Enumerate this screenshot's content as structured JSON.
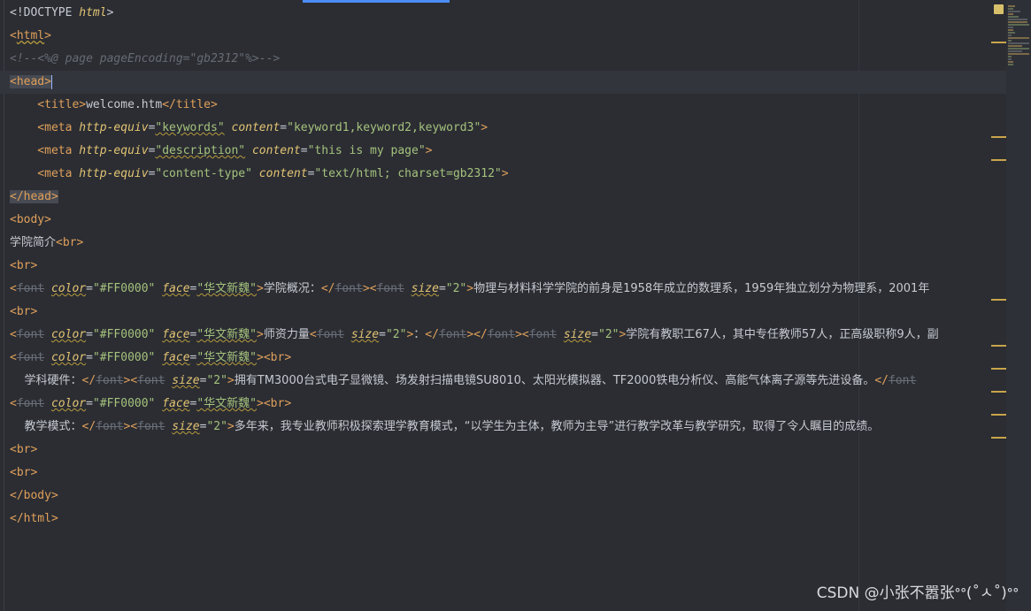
{
  "editor": {
    "lines": [
      {
        "tokens": [
          {
            "t": "<!DOCTYPE ",
            "c": "tk-doctype"
          },
          {
            "t": "html",
            "c": "tk-doctype-name"
          },
          {
            "t": ">",
            "c": "tk-doctype"
          }
        ]
      },
      {
        "tokens": [
          {
            "t": "<",
            "c": "tk-tag"
          },
          {
            "t": "html",
            "c": "tk-tag squigt"
          },
          {
            "t": ">",
            "c": "tk-tag"
          }
        ]
      },
      {
        "tokens": [
          {
            "t": "<!--<%@ page pageEncoding=\"gb2312\"%>-->",
            "c": "tk-comment"
          }
        ]
      },
      {
        "current": true,
        "tokens": [
          {
            "t": "<head>",
            "c": "tk-tag tagbox"
          },
          {
            "t": "",
            "c": "cursor"
          }
        ]
      },
      {
        "tokens": [
          {
            "t": "    <",
            "c": "tk-tag"
          },
          {
            "t": "title",
            "c": "tk-tag"
          },
          {
            "t": ">",
            "c": "tk-tag"
          },
          {
            "t": "welcome.htm",
            "c": "tk-punc"
          },
          {
            "t": "</",
            "c": "tk-tag"
          },
          {
            "t": "title",
            "c": "tk-tag"
          },
          {
            "t": ">",
            "c": "tk-tag"
          }
        ]
      },
      {
        "tokens": [
          {
            "t": "    <",
            "c": "tk-tag"
          },
          {
            "t": "meta ",
            "c": "tk-tag"
          },
          {
            "t": "http-equiv",
            "c": "tk-attr"
          },
          {
            "t": "=",
            "c": "tk-eq"
          },
          {
            "t": "\"keywords\"",
            "c": "tk-str squig"
          },
          {
            "t": " ",
            "c": "tk-punc"
          },
          {
            "t": "content",
            "c": "tk-attr"
          },
          {
            "t": "=",
            "c": "tk-eq"
          },
          {
            "t": "\"keyword1,keyword2,keyword3\"",
            "c": "tk-str"
          },
          {
            "t": ">",
            "c": "tk-tag"
          }
        ]
      },
      {
        "tokens": [
          {
            "t": "    <",
            "c": "tk-tag"
          },
          {
            "t": "meta ",
            "c": "tk-tag"
          },
          {
            "t": "http-equiv",
            "c": "tk-attr"
          },
          {
            "t": "=",
            "c": "tk-eq"
          },
          {
            "t": "\"description\"",
            "c": "tk-str squig"
          },
          {
            "t": " ",
            "c": "tk-punc"
          },
          {
            "t": "content",
            "c": "tk-attr"
          },
          {
            "t": "=",
            "c": "tk-eq"
          },
          {
            "t": "\"this is my page\"",
            "c": "tk-str"
          },
          {
            "t": ">",
            "c": "tk-tag"
          }
        ]
      },
      {
        "tokens": [
          {
            "t": "    <",
            "c": "tk-tag"
          },
          {
            "t": "meta ",
            "c": "tk-tag"
          },
          {
            "t": "http-equiv",
            "c": "tk-attr"
          },
          {
            "t": "=",
            "c": "tk-eq"
          },
          {
            "t": "\"content-type\"",
            "c": "tk-str"
          },
          {
            "t": " ",
            "c": "tk-punc"
          },
          {
            "t": "content",
            "c": "tk-attr"
          },
          {
            "t": "=",
            "c": "tk-eq"
          },
          {
            "t": "\"text/html; charset=gb2312\"",
            "c": "tk-str"
          },
          {
            "t": ">",
            "c": "tk-tag"
          }
        ]
      },
      {
        "tokens": [
          {
            "t": "</head>",
            "c": "tk-tag tagbox"
          }
        ]
      },
      {
        "tokens": [
          {
            "t": "<",
            "c": "tk-tag"
          },
          {
            "t": "body",
            "c": "tk-tag"
          },
          {
            "t": ">",
            "c": "tk-tag"
          }
        ]
      },
      {
        "tokens": [
          {
            "t": "学院简介",
            "c": "tk-text"
          },
          {
            "t": "<",
            "c": "tk-tag"
          },
          {
            "t": "br",
            "c": "tk-tag"
          },
          {
            "t": ">",
            "c": "tk-tag"
          }
        ]
      },
      {
        "tokens": [
          {
            "t": "<",
            "c": "tk-tag"
          },
          {
            "t": "br",
            "c": "tk-tag"
          },
          {
            "t": ">",
            "c": "tk-tag"
          }
        ]
      },
      {
        "tokens": [
          {
            "t": "<",
            "c": "tk-tag"
          },
          {
            "t": "font",
            "c": "tk-strike"
          },
          {
            "t": " ",
            "c": "tk-punc"
          },
          {
            "t": "color",
            "c": "tk-attr squig"
          },
          {
            "t": "=",
            "c": "tk-eq"
          },
          {
            "t": "\"#FF0000\"",
            "c": "tk-str"
          },
          {
            "t": " ",
            "c": "tk-punc"
          },
          {
            "t": "face",
            "c": "tk-attr squig"
          },
          {
            "t": "=",
            "c": "tk-eq"
          },
          {
            "t": "\"华文新魏\"",
            "c": "tk-str squig"
          },
          {
            "t": ">",
            "c": "tk-tag"
          },
          {
            "t": "学院概况：",
            "c": "tk-text"
          },
          {
            "t": "</",
            "c": "tk-tag"
          },
          {
            "t": "font",
            "c": "tk-strike"
          },
          {
            "t": ">",
            "c": "tk-tag"
          },
          {
            "t": "<",
            "c": "tk-tag"
          },
          {
            "t": "font",
            "c": "tk-strike"
          },
          {
            "t": " ",
            "c": "tk-punc"
          },
          {
            "t": "size",
            "c": "tk-attr squig"
          },
          {
            "t": "=",
            "c": "tk-eq"
          },
          {
            "t": "\"2\"",
            "c": "tk-str"
          },
          {
            "t": ">",
            "c": "tk-tag"
          },
          {
            "t": "物理与材料科学学院的前身是1958年成立的数理系，1959年独立划分为物理系，2001年",
            "c": "tk-text"
          }
        ]
      },
      {
        "tokens": [
          {
            "t": "<",
            "c": "tk-tag"
          },
          {
            "t": "br",
            "c": "tk-tag"
          },
          {
            "t": ">",
            "c": "tk-tag"
          }
        ]
      },
      {
        "tokens": [
          {
            "t": "<",
            "c": "tk-tag"
          },
          {
            "t": "font",
            "c": "tk-strike"
          },
          {
            "t": " ",
            "c": "tk-punc"
          },
          {
            "t": "color",
            "c": "tk-attr squig"
          },
          {
            "t": "=",
            "c": "tk-eq"
          },
          {
            "t": "\"#FF0000\"",
            "c": "tk-str"
          },
          {
            "t": " ",
            "c": "tk-punc"
          },
          {
            "t": "face",
            "c": "tk-attr squig"
          },
          {
            "t": "=",
            "c": "tk-eq"
          },
          {
            "t": "\"华文新魏\"",
            "c": "tk-str squig"
          },
          {
            "t": ">",
            "c": "tk-tag"
          },
          {
            "t": "师资力量",
            "c": "tk-text"
          },
          {
            "t": "<",
            "c": "tk-tag"
          },
          {
            "t": "font",
            "c": "tk-strike"
          },
          {
            "t": " ",
            "c": "tk-punc"
          },
          {
            "t": "size",
            "c": "tk-attr squig"
          },
          {
            "t": "=",
            "c": "tk-eq"
          },
          {
            "t": "\"2\"",
            "c": "tk-str"
          },
          {
            "t": ">",
            "c": "tk-tag"
          },
          {
            "t": "：",
            "c": "tk-text"
          },
          {
            "t": "</",
            "c": "tk-tag"
          },
          {
            "t": "font",
            "c": "tk-strike"
          },
          {
            "t": ">",
            "c": "tk-tag"
          },
          {
            "t": "</",
            "c": "tk-tag"
          },
          {
            "t": "font",
            "c": "tk-strike"
          },
          {
            "t": ">",
            "c": "tk-tag"
          },
          {
            "t": "<",
            "c": "tk-tag"
          },
          {
            "t": "font",
            "c": "tk-strike"
          },
          {
            "t": " ",
            "c": "tk-punc"
          },
          {
            "t": "size",
            "c": "tk-attr squig"
          },
          {
            "t": "=",
            "c": "tk-eq"
          },
          {
            "t": "\"2\"",
            "c": "tk-str"
          },
          {
            "t": ">",
            "c": "tk-tag"
          },
          {
            "t": "学院有教职工67人，其中专任教师57人，正高级职称9人，副",
            "c": "tk-text"
          }
        ]
      },
      {
        "tokens": [
          {
            "t": "<",
            "c": "tk-tag"
          },
          {
            "t": "font",
            "c": "tk-strike"
          },
          {
            "t": " ",
            "c": "tk-punc"
          },
          {
            "t": "color",
            "c": "tk-attr squig"
          },
          {
            "t": "=",
            "c": "tk-eq"
          },
          {
            "t": "\"#FF0000\"",
            "c": "tk-str"
          },
          {
            "t": " ",
            "c": "tk-punc"
          },
          {
            "t": "face",
            "c": "tk-attr squig"
          },
          {
            "t": "=",
            "c": "tk-eq"
          },
          {
            "t": "\"华文新魏\"",
            "c": "tk-str squig"
          },
          {
            "t": ">",
            "c": "tk-tag"
          },
          {
            "t": "<",
            "c": "tk-tag"
          },
          {
            "t": "br",
            "c": "tk-tag"
          },
          {
            "t": ">",
            "c": "tk-tag"
          }
        ]
      },
      {
        "tokens": [
          {
            "t": "    学科硬件：",
            "c": "tk-text"
          },
          {
            "t": "</",
            "c": "tk-tag"
          },
          {
            "t": "font",
            "c": "tk-strike"
          },
          {
            "t": ">",
            "c": "tk-tag"
          },
          {
            "t": "<",
            "c": "tk-tag"
          },
          {
            "t": "font",
            "c": "tk-strike"
          },
          {
            "t": " ",
            "c": "tk-punc"
          },
          {
            "t": "size",
            "c": "tk-attr squig"
          },
          {
            "t": "=",
            "c": "tk-eq"
          },
          {
            "t": "\"2\"",
            "c": "tk-str"
          },
          {
            "t": ">",
            "c": "tk-tag"
          },
          {
            "t": "拥有TM3000台式电子显微镜、场发射扫描电镜SU8010、太阳光模拟器、TF2000铁电分析仪、高能气体离子源等先进设备。",
            "c": "tk-text"
          },
          {
            "t": "</",
            "c": "tk-tag"
          },
          {
            "t": "font",
            "c": "tk-strike"
          }
        ]
      },
      {
        "tokens": [
          {
            "t": "<",
            "c": "tk-tag"
          },
          {
            "t": "font",
            "c": "tk-strike"
          },
          {
            "t": " ",
            "c": "tk-punc"
          },
          {
            "t": "color",
            "c": "tk-attr squig"
          },
          {
            "t": "=",
            "c": "tk-eq"
          },
          {
            "t": "\"#FF0000\"",
            "c": "tk-str"
          },
          {
            "t": " ",
            "c": "tk-punc"
          },
          {
            "t": "face",
            "c": "tk-attr squig"
          },
          {
            "t": "=",
            "c": "tk-eq"
          },
          {
            "t": "\"华文新魏\"",
            "c": "tk-str squig"
          },
          {
            "t": ">",
            "c": "tk-tag"
          },
          {
            "t": "<",
            "c": "tk-tag"
          },
          {
            "t": "br",
            "c": "tk-tag"
          },
          {
            "t": ">",
            "c": "tk-tag"
          }
        ]
      },
      {
        "tokens": [
          {
            "t": "    教学模式：",
            "c": "tk-text"
          },
          {
            "t": "</",
            "c": "tk-tag"
          },
          {
            "t": "font",
            "c": "tk-strike"
          },
          {
            "t": ">",
            "c": "tk-tag"
          },
          {
            "t": "<",
            "c": "tk-tag"
          },
          {
            "t": "font",
            "c": "tk-strike"
          },
          {
            "t": " ",
            "c": "tk-punc"
          },
          {
            "t": "size",
            "c": "tk-attr squig"
          },
          {
            "t": "=",
            "c": "tk-eq"
          },
          {
            "t": "\"2\"",
            "c": "tk-str"
          },
          {
            "t": ">",
            "c": "tk-tag"
          },
          {
            "t": "多年来，我专业教师积极探索理学教育模式，“以学生为主体，教师为主导”进行教学改革与教学研究，取得了令人瞩目的成绩。",
            "c": "tk-text"
          }
        ]
      },
      {
        "tokens": [
          {
            "t": "<",
            "c": "tk-tag"
          },
          {
            "t": "br",
            "c": "tk-tag"
          },
          {
            "t": ">",
            "c": "tk-tag"
          }
        ]
      },
      {
        "tokens": [
          {
            "t": "<",
            "c": "tk-tag"
          },
          {
            "t": "br",
            "c": "tk-tag"
          },
          {
            "t": ">",
            "c": "tk-tag"
          }
        ]
      },
      {
        "tokens": [
          {
            "t": "</",
            "c": "tk-tag"
          },
          {
            "t": "body",
            "c": "tk-tag"
          },
          {
            "t": ">",
            "c": "tk-tag"
          }
        ]
      },
      {
        "tokens": [
          {
            "t": "</",
            "c": "tk-tag"
          },
          {
            "t": "html",
            "c": "tk-tag"
          },
          {
            "t": ">",
            "c": "tk-tag"
          }
        ]
      }
    ]
  },
  "colors": {
    "background": "#2b2d33",
    "tag": "#e0a05a",
    "attribute": "#e3c473",
    "string": "#a5c27c",
    "comment": "#676b73",
    "accent": "#4c8df6",
    "warning_marker": "#c9a54a"
  },
  "watermark": {
    "text": "CSDN @小张不嚣张ᐤᐤ(˚ㅅ˚)ᐤᐤ"
  }
}
